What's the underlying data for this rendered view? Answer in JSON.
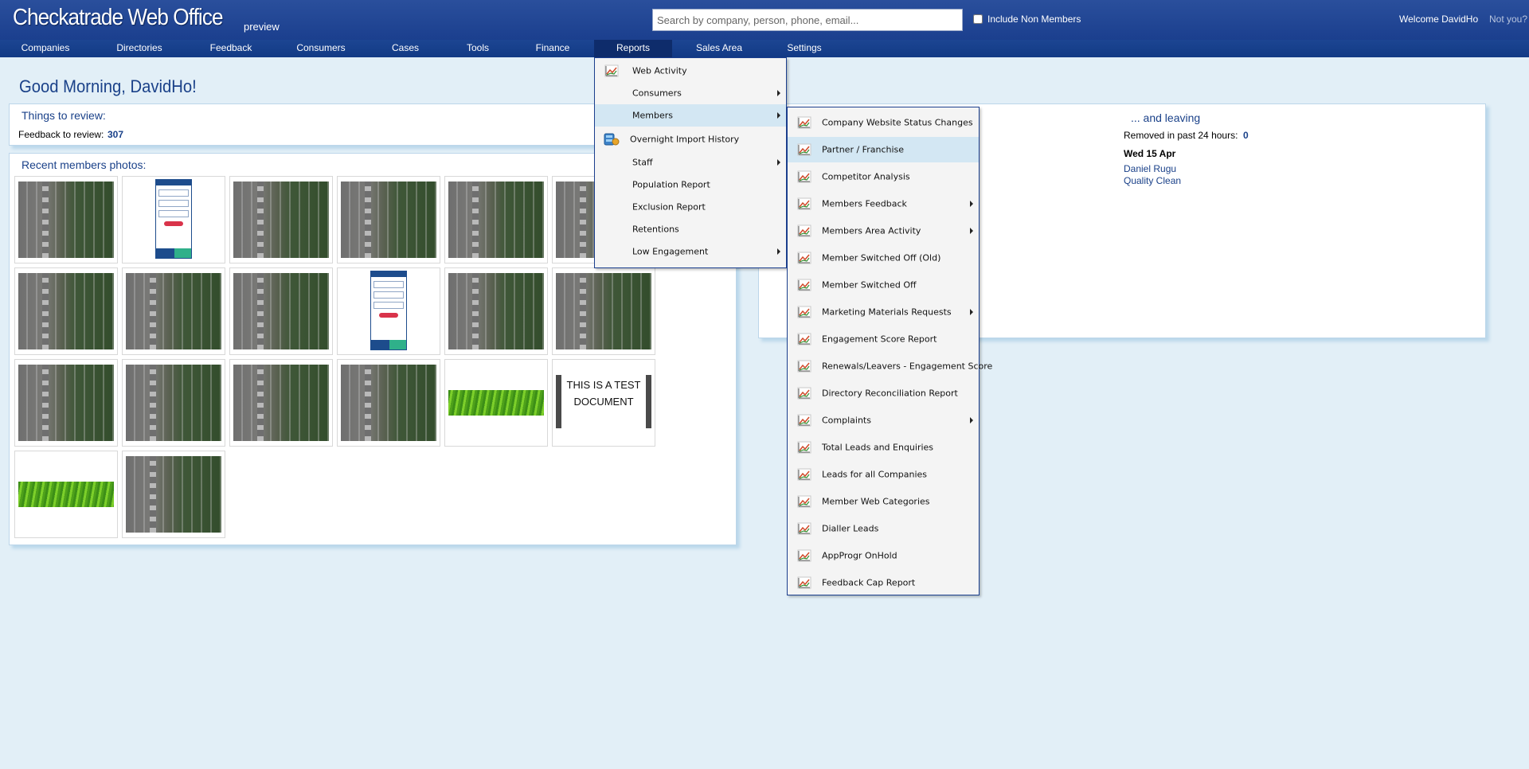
{
  "header": {
    "brand": "Checkatrade Web Office",
    "preview": "preview",
    "search_placeholder": "Search by company, person, phone, email...",
    "include_non_members": "Include Non Members",
    "welcome": "Welcome DavidHo",
    "not_you": "Not you?"
  },
  "nav": {
    "items": [
      "Companies",
      "Directories",
      "Feedback",
      "Consumers",
      "Cases",
      "Tools",
      "Finance",
      "Reports",
      "Sales Area",
      "Settings"
    ],
    "active": "Reports"
  },
  "main": {
    "greeting": "Good Morning, DavidHo!",
    "review": {
      "title": "Things to review:",
      "feedback_label": "Feedback to review:",
      "feedback_count": "307"
    },
    "photos": {
      "title": "Recent members photos:",
      "doc_text": "THIS IS A TEST DOCUMENT",
      "items": [
        "street",
        "phone",
        "street",
        "street",
        "street",
        "street",
        "street",
        "street",
        "street",
        "phone",
        "street",
        "street",
        "street",
        "street",
        "street",
        "street",
        "grass",
        "document",
        "grass",
        "street"
      ]
    },
    "leaving": {
      "title": "... and leaving",
      "removed_label": "Removed in past 24 hours:",
      "removed_count": "0",
      "date": "Wed 15 Apr",
      "names": [
        "Daniel Rugu",
        "Quality Clean"
      ]
    }
  },
  "reports_menu": {
    "items": [
      {
        "label": "Web Activity",
        "icon": "chart-icon",
        "submenu": false
      },
      {
        "label": "Consumers",
        "icon": "",
        "submenu": true
      },
      {
        "label": "Members",
        "icon": "",
        "submenu": true,
        "highlighted": true
      },
      {
        "label": "Overnight Import History",
        "icon": "database-icon",
        "submenu": false
      },
      {
        "label": "Staff",
        "icon": "",
        "submenu": true
      },
      {
        "label": "Population Report",
        "icon": "",
        "submenu": false
      },
      {
        "label": "Exclusion Report",
        "icon": "",
        "submenu": false
      },
      {
        "label": "Retentions",
        "icon": "",
        "submenu": false
      },
      {
        "label": "Low Engagement",
        "icon": "",
        "submenu": true
      }
    ]
  },
  "members_submenu": {
    "items": [
      {
        "label": "Company Website Status Changes",
        "submenu": false
      },
      {
        "label": "Partner / Franchise",
        "submenu": false,
        "highlighted": true
      },
      {
        "label": "Competitor Analysis",
        "submenu": false
      },
      {
        "label": "Members Feedback",
        "submenu": true
      },
      {
        "label": "Members Area Activity",
        "submenu": true
      },
      {
        "label": "Member Switched Off (Old)",
        "submenu": false
      },
      {
        "label": "Member Switched Off",
        "submenu": false
      },
      {
        "label": "Marketing Materials Requests",
        "submenu": true
      },
      {
        "label": "Engagement Score Report",
        "submenu": false
      },
      {
        "label": "Renewals/Leavers - Engagement Score",
        "submenu": false
      },
      {
        "label": "Directory Reconciliation Report",
        "submenu": false
      },
      {
        "label": "Complaints",
        "submenu": true
      },
      {
        "label": "Total Leads and Enquiries",
        "submenu": false
      },
      {
        "label": "Leads for all Companies",
        "submenu": false
      },
      {
        "label": "Member Web Categories",
        "submenu": false
      },
      {
        "label": "Dialler Leads",
        "submenu": false
      },
      {
        "label": "AppProgr OnHold",
        "submenu": false
      },
      {
        "label": "Feedback Cap Report",
        "submenu": false
      }
    ]
  },
  "colors": {
    "header_bg": "#1b3f8e",
    "page_bg": "#e2eff7",
    "link": "#1a4189",
    "menu_highlight": "#d3e7f3"
  }
}
